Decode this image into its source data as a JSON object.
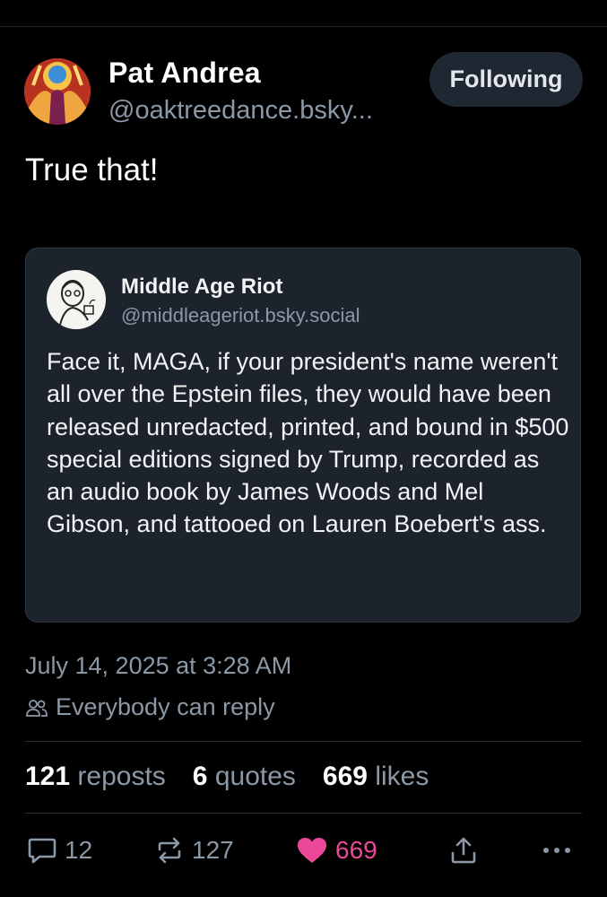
{
  "author": {
    "name": "Pat Andrea",
    "handle": "@oaktreedance.bsky...",
    "follow_label": "Following"
  },
  "post": {
    "text": "True that!"
  },
  "quote": {
    "name": "Middle Age Riot",
    "handle": "@middleageriot.bsky.social",
    "text": "Face it, MAGA, if your president's name weren't all over the Epstein files, they would have been released unredacted, printed, and bound in $500 special editions signed by Trump, recorded as an audio book by James Woods and Mel Gibson, and tattooed on Lauren Boebert's ass."
  },
  "meta": {
    "timestamp": "July 14, 2025 at 3:28 AM",
    "reply_setting": "Everybody can reply"
  },
  "stats": {
    "reposts_count": "121",
    "reposts_label": "reposts",
    "quotes_count": "6",
    "quotes_label": "quotes",
    "likes_count": "669",
    "likes_label": "likes"
  },
  "actions": {
    "reply_count": "12",
    "repost_count": "127",
    "like_count": "669"
  },
  "icons": {
    "reply": "reply-icon",
    "repost": "repost-icon",
    "like": "heart-icon",
    "share": "share-icon",
    "more": "more-icon",
    "reply_setting": "people-icon"
  },
  "colors": {
    "background": "#000000",
    "card": "#1c232c",
    "muted": "#8b98a5",
    "like": "#ec4899",
    "follow_button": "#1e2732"
  }
}
